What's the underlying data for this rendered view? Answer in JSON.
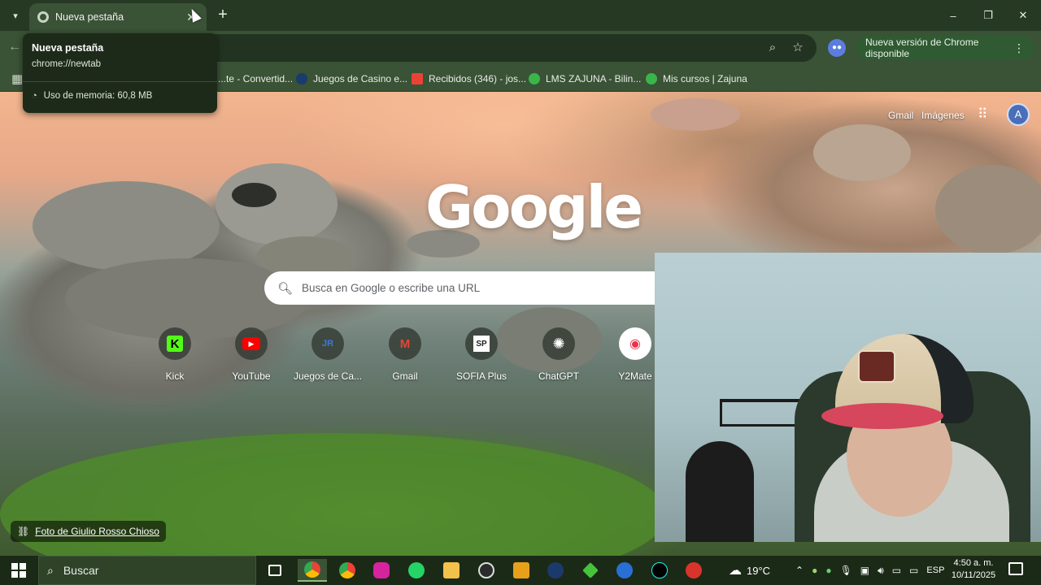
{
  "browser": {
    "tab": {
      "title": "Nueva pestaña",
      "close_icon": "close-icon"
    },
    "new_tab_glyph": "+",
    "window_controls": {
      "minimize": "–",
      "maximize": "❐",
      "close": "✕"
    },
    "update_chip": "Nueva versión de Chrome disponible",
    "tab_hovercard": {
      "title": "Nueva pestaña",
      "url": "chrome://newtab",
      "memory": "Uso de memoria: 60,8 MB"
    }
  },
  "bookmarks": [
    {
      "label": "...te - Convertid...",
      "color": "#e0e0e0"
    },
    {
      "label": "Juegos de Casino e...",
      "color": "#1a3b6e"
    },
    {
      "label": "Recibidos (346) - jos...",
      "color": "#ea4335"
    },
    {
      "label": "LMS ZAJUNA - Bilin...",
      "color": "#39b54a"
    },
    {
      "label": "Mis cursos | Zajuna",
      "color": "#39b54a"
    }
  ],
  "ntp": {
    "links": {
      "gmail": "Gmail",
      "images": "Imágenes"
    },
    "logo": "Google",
    "search_placeholder": "Busca en Google o escribe una URL",
    "shortcuts": [
      {
        "label": "Kick",
        "glyph": "K",
        "color": "#53fc18"
      },
      {
        "label": "YouTube",
        "glyph": "▶",
        "color": "#ff0000"
      },
      {
        "label": "Juegos de Ca...",
        "glyph": "JR",
        "color": "#1e4d8c"
      },
      {
        "label": "Gmail",
        "glyph": "M",
        "color": "#ea4335"
      },
      {
        "label": "SOFIA Plus",
        "glyph": "SP",
        "color": "#ffffff"
      },
      {
        "label": "ChatGPT",
        "glyph": "✺",
        "color": "#ffffff"
      },
      {
        "label": "Y2Mate",
        "glyph": "◉",
        "color": "#e8324a"
      }
    ],
    "photo_credit": "Foto de Giulio Rosso Chioso"
  },
  "taskbar": {
    "search_label": "Buscar",
    "weather": "19°C",
    "language": "ESP",
    "time": "4:50 a. m.",
    "date": "10/11/2025"
  }
}
